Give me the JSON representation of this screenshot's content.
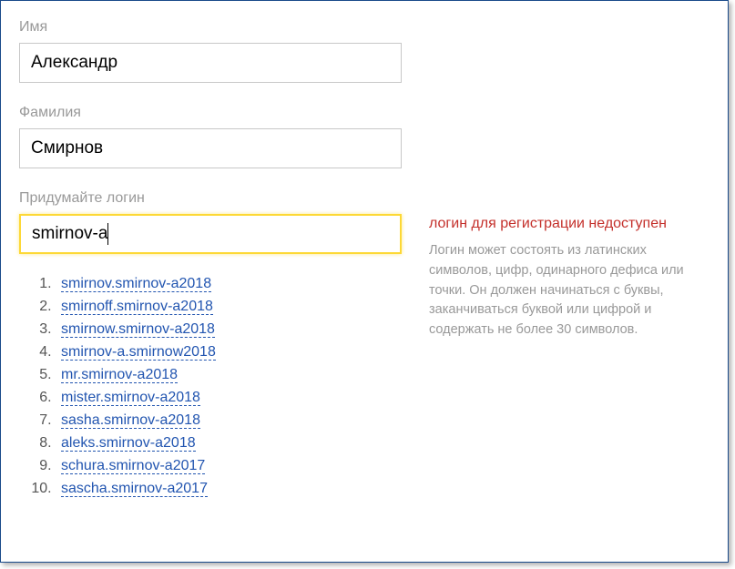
{
  "form": {
    "firstname_label": "Имя",
    "firstname_value": "Александр",
    "lastname_label": "Фамилия",
    "lastname_value": "Смирнов",
    "login_label": "Придумайте логин",
    "login_value": "smirnov-a"
  },
  "error": {
    "title": "логин для регистрации недоступен",
    "hint": "Логин может состоять из латинских символов, цифр, одинарного дефиса или точки. Он должен начинаться с буквы, заканчиваться буквой или цифрой и содержать не более 30 символов."
  },
  "suggestions": [
    "smirnov.smirnov-a2018",
    "smirnoff.smirnov-a2018",
    "smirnow.smirnov-a2018",
    "smirnov-a.smirnow2018",
    "mr.smirnov-a2018",
    "mister.smirnov-a2018",
    "sasha.smirnov-a2018",
    "aleks.smirnov-a2018",
    "schura.smirnov-a2017",
    "sascha.smirnov-a2017"
  ]
}
